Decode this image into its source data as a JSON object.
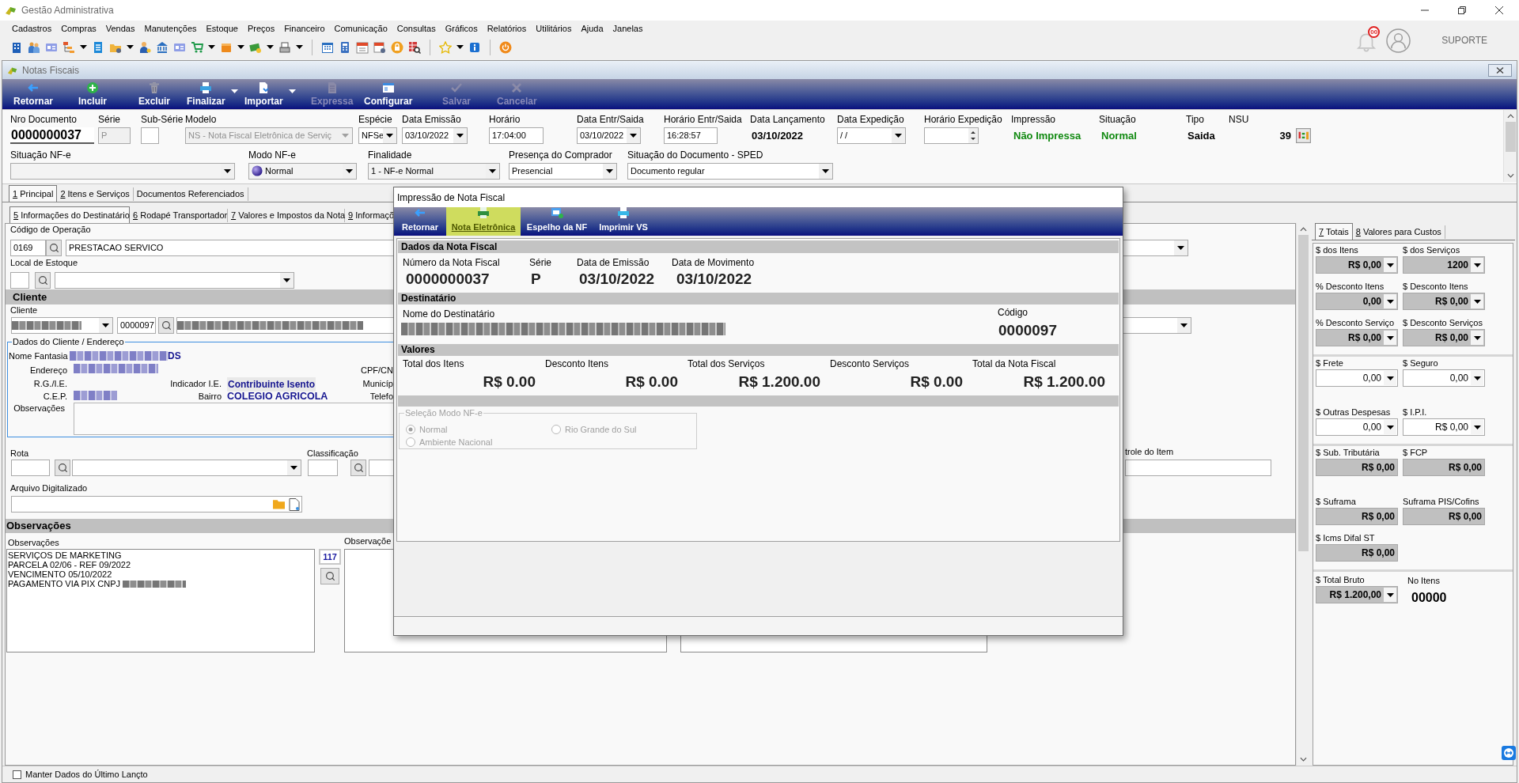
{
  "app": {
    "title": "Gestão Administrativa",
    "notifications": "00",
    "user": "SUPORTE"
  },
  "menu": [
    "Cadastros",
    "Compras",
    "Vendas",
    "Manutenções",
    "Estoque",
    "Preços",
    "Financeiro",
    "Comunicação",
    "Consultas",
    "Gráficos",
    "Relatórios",
    "Utilitários",
    "Ajuda",
    "Janelas"
  ],
  "window": {
    "title": "Notas Fiscais"
  },
  "actions": [
    {
      "label": "Retornar",
      "disabled": false,
      "menu": false
    },
    {
      "label": "Incluir",
      "disabled": false,
      "menu": false
    },
    {
      "label": "Excluir",
      "disabled": false,
      "menu": false
    },
    {
      "label": "Finalizar",
      "disabled": false,
      "menu": true
    },
    {
      "label": "Importar",
      "disabled": false,
      "menu": true
    },
    {
      "label": "Expressa",
      "disabled": true,
      "menu": false
    },
    {
      "label": "Configurar",
      "disabled": false,
      "menu": false
    },
    {
      "label": "Salvar",
      "disabled": true,
      "menu": false
    },
    {
      "label": "Cancelar",
      "disabled": true,
      "menu": false
    }
  ],
  "header": {
    "row_1": [
      {
        "kind": "number",
        "label": "Nro Documento",
        "value": "0000000037",
        "disabled": false
      },
      {
        "kind": "input",
        "label": "Série",
        "value": "P",
        "disabled": true
      },
      {
        "kind": "input",
        "label": "Sub-Série",
        "disabled": false
      },
      {
        "kind": "select",
        "label": "Modelo",
        "value": "NS - Nota Fiscal Eletrônica de Serviç",
        "disabled": true
      },
      {
        "kind": "select",
        "label": "Espécie",
        "value": "NFSe",
        "disabled": false
      },
      {
        "kind": "select",
        "label": "Data Emissão",
        "value": "03/10/2022",
        "disabled": false
      },
      {
        "kind": "input",
        "label": "Horário",
        "value": "17:04:00",
        "disabled": false
      },
      {
        "kind": "select",
        "label": "Data Entr/Saida",
        "value": "03/10/2022",
        "disabled": false
      },
      {
        "kind": "input",
        "label": "Horário Entr/Saida",
        "value": "16:28:57",
        "disabled": false
      },
      {
        "kind": "text",
        "label": "Data Lançamento",
        "value": "03/10/2022",
        "disabled": false
      },
      {
        "kind": "select",
        "label": "Data Expedição",
        "value": "/ /",
        "disabled": false
      },
      {
        "kind": "spin",
        "label": "Horário Expedição",
        "disabled": false
      },
      {
        "kind": "status",
        "label": "Impressão",
        "value": "Não Impressa",
        "disabled": false
      },
      {
        "kind": "status",
        "label": "Situação",
        "value": "Normal",
        "disabled": false
      },
      {
        "kind": "text",
        "label": "Tipo",
        "value": "Saida",
        "disabled": false
      },
      {
        "kind": "nsu",
        "label": "NSU",
        "value": "39",
        "disabled": false
      }
    ],
    "row_2": [
      {
        "kind": "select",
        "label": "Situação NF-e"
      },
      {
        "kind": "icon_select",
        "label": "Modo NF-e",
        "value": "Normal"
      },
      {
        "kind": "select",
        "label": "Finalidade",
        "value": "1 - NF-e Normal"
      },
      {
        "kind": "select",
        "label": "Presença do Comprador",
        "value": "Presencial"
      },
      {
        "kind": "select",
        "label": "Situação do Documento - SPED",
        "value": "Documento regular"
      }
    ]
  },
  "tabs": [
    {
      "key": "1",
      "label": "Principal",
      "selected": true
    },
    {
      "key": "2",
      "label": "Itens e Serviços",
      "selected": false
    },
    {
      "label": "Documentos Referenciados",
      "selected": false
    }
  ],
  "subtabs": [
    {
      "key": "5",
      "label": "Informações do Destinatário",
      "selected": true
    },
    {
      "key": "6",
      "label": "Rodapé Transportador",
      "selected": false
    },
    {
      "key": "7",
      "label": "Valores e Impostos da Nota",
      "selected": false
    },
    {
      "key": "9",
      "label": "Informaçõ",
      "selected": false
    }
  ],
  "main": {
    "operation": {
      "label": "Código de Operação",
      "code": "0169",
      "description": "PRESTACAO SERVICO"
    },
    "stock": {
      "label": "Local de Estoque"
    },
    "client_section": "Cliente",
    "client": {
      "label": "Cliente",
      "code": "0000097"
    },
    "client_data": {
      "title": "Dados do Cliente / Endereço",
      "trade_name": {
        "label": "Nome Fantasia",
        "value": "DS"
      },
      "address_label": "Endereço",
      "rg_label": "R.G./I.E.",
      "cep_label": "C.E.P.",
      "ie_indicator": {
        "label": "Indicador I.E.",
        "value": "Contribuinte Isento"
      },
      "district": {
        "label": "Bairro",
        "value": "COLEGIO AGRICOLA"
      },
      "right_labels": [
        "CPF/CN",
        "Municíp",
        "Telefo"
      ],
      "notes_label": "Observações"
    },
    "route": {
      "label": "Rota"
    },
    "classification": {
      "label": "Classificação"
    },
    "item_control": {
      "label": "trole do Item"
    },
    "scanned_file": {
      "label": "Arquivo Digitalizado"
    },
    "notes": {
      "title": "Observações",
      "label": "Observações",
      "lines": [
        "SERVIÇOS DE MARKETING",
        "PARCELA 02/06 - REF 09/2022",
        "VENCIMENTO 05/10/2022",
        "PAGAMENTO VIA PIX CNPJ"
      ],
      "count": "117",
      "second_label": "Observaçõe"
    }
  },
  "totals": {
    "tabs": [
      {
        "key": "7",
        "label": "Totais",
        "selected": true
      },
      {
        "key": "8",
        "label": "Valores para Custos",
        "selected": false
      }
    ],
    "groups": [
      [
        {
          "kind": "readonly",
          "label": "$ dos Itens",
          "value": "R$ 0,00",
          "menu": true
        },
        {
          "kind": "readonly",
          "label": "$ dos Serviços",
          "value": "1200",
          "menu": true
        },
        {
          "kind": "readonly",
          "label": "% Desconto Itens",
          "value": "0,00",
          "menu": true
        },
        {
          "kind": "readonly",
          "label": "$ Desconto Itens",
          "value": "R$ 0,00",
          "menu": true
        },
        {
          "kind": "readonly",
          "label": "% Desconto Serviço",
          "value": "R$ 0,00",
          "menu": true
        },
        {
          "kind": "readonly",
          "label": "$ Desconto Serviços",
          "value": "R$ 0,00",
          "menu": true
        }
      ],
      [
        {
          "kind": "input",
          "label": "$ Frete",
          "value": "0,00",
          "menu": true
        },
        {
          "kind": "input",
          "label": "$ Seguro",
          "value": "0,00",
          "menu": true
        },
        {
          "kind": "input",
          "label": "$ Outras Despesas",
          "value": "0,00",
          "menu": true
        },
        {
          "kind": "input",
          "label": "$ I.P.I.",
          "value": "R$ 0,00",
          "menu": true
        }
      ],
      [
        {
          "kind": "readonly",
          "label": "$ Sub. Tributária",
          "value": "R$ 0,00",
          "menu": false
        },
        {
          "kind": "readonly",
          "label": "$ FCP",
          "value": "R$ 0,00",
          "menu": false
        },
        {
          "kind": "readonly",
          "label": "$ Suframa",
          "value": "R$ 0,00",
          "menu": false
        },
        {
          "kind": "readonly",
          "label": "Suframa PIS/Cofins",
          "value": "R$ 0,00",
          "menu": false
        },
        {
          "kind": "readonly",
          "label": "$ Icms Difal ST",
          "value": "R$ 0,00",
          "menu": false
        }
      ],
      [
        {
          "kind": "readonly",
          "label": "$ Total Bruto",
          "value": "R$ 1.200,00",
          "menu": true
        },
        {
          "kind": "count",
          "label": "No Itens",
          "value": "00000"
        }
      ]
    ]
  },
  "footer": {
    "label": "Manter Dados do Último Lançto",
    "checked": false
  },
  "dialog": {
    "title": "Impressão de Nota Fiscal",
    "actions": [
      {
        "label": "Retornar",
        "selected": false
      },
      {
        "label": "Nota Eletrônica",
        "selected": true
      },
      {
        "label": "Espelho da NF",
        "selected": false
      },
      {
        "label": "Imprimir VS",
        "selected": false
      }
    ],
    "invoice": {
      "title": "Dados da Nota Fiscal",
      "fields": [
        {
          "label": "Número da Nota Fiscal",
          "value": "0000000037"
        },
        {
          "label": "Série",
          "value": "P"
        },
        {
          "label": "Data de Emissão",
          "value": "03/10/2022"
        },
        {
          "label": "Data de Movimento",
          "value": "03/10/2022"
        }
      ]
    },
    "recipient": {
      "title": "Destinatário",
      "name_label": "Nome do Destinatário",
      "code_label": "Código",
      "code": "0000097"
    },
    "values": {
      "title": "Valores",
      "fields": [
        {
          "label": "Total dos Itens",
          "value": "R$ 0.00"
        },
        {
          "label": "Desconto Itens",
          "value": "R$ 0.00"
        },
        {
          "label": "Total dos Serviços",
          "value": "R$ 1.200.00"
        },
        {
          "label": "Desconto Serviços",
          "value": "R$ 0.00"
        },
        {
          "label": "Total da Nota Fiscal",
          "value": "R$ 1.200.00"
        }
      ]
    },
    "mode_group": {
      "title": "Seleção Modo NF-e",
      "disabled": true,
      "options": [
        {
          "label": "Normal",
          "selected": true
        },
        {
          "label": "Rio Grande do Sul",
          "selected": false
        },
        {
          "label": "Ambiente Nacional",
          "selected": false
        }
      ]
    }
  }
}
